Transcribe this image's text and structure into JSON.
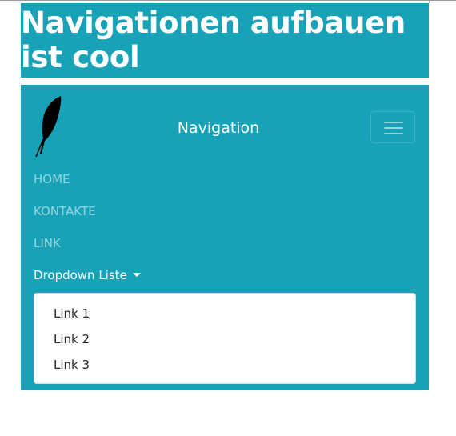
{
  "header": {
    "title": "Navigationen aufbauen ist cool"
  },
  "navbar": {
    "brand_logo": "feather-icon",
    "brand_title": "Navigation",
    "toggler_icon": "hamburger-menu-icon",
    "links": [
      {
        "label": "HOME"
      },
      {
        "label": "KONTAKTE"
      },
      {
        "label": "LINK"
      }
    ],
    "dropdown": {
      "label": "Dropdown Liste",
      "caret_icon": "caret-down-icon",
      "items": [
        {
          "label": "Link 1"
        },
        {
          "label": "Link 2"
        },
        {
          "label": "Link 3"
        }
      ]
    }
  },
  "colors": {
    "primary": "#17a2b8",
    "nav_text_muted": "rgba(255,255,255,0.55)",
    "nav_text_active": "#ffffff",
    "dropdown_bg": "#ffffff",
    "dropdown_text": "#212529"
  }
}
